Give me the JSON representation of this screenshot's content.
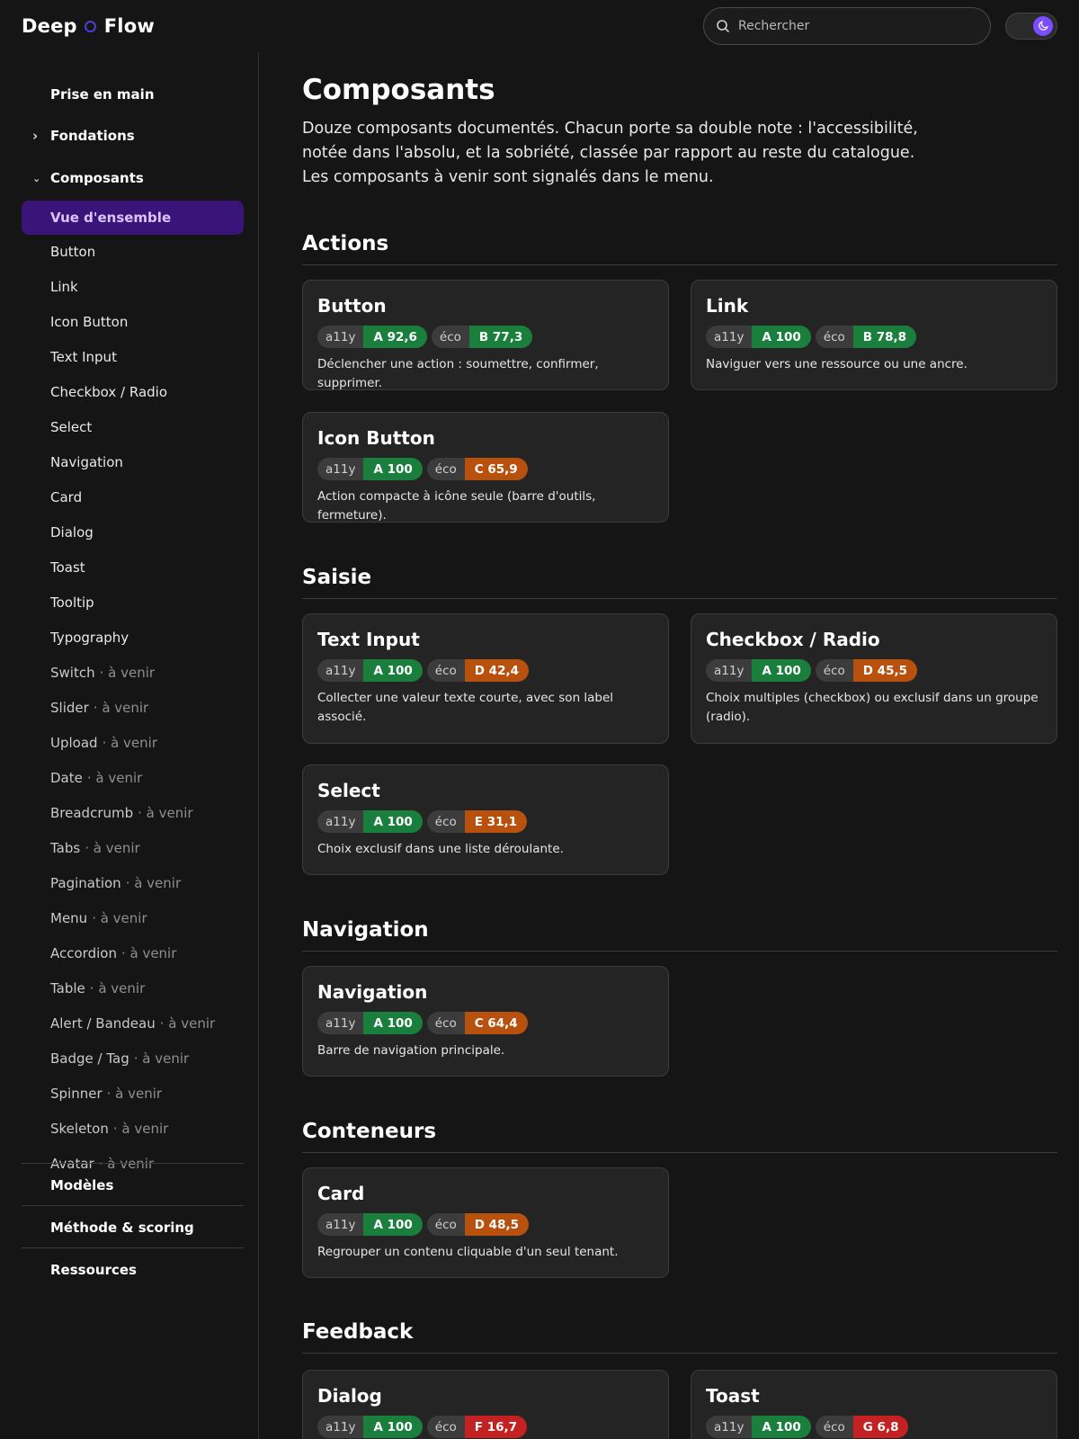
{
  "header": {
    "logo_left": "Deep",
    "logo_right": "Flow",
    "search_placeholder": "Rechercher",
    "theme_toggle": "moon-icon"
  },
  "sidebar": {
    "top_sections": [
      "Prise en main",
      "Fondations",
      "Composants"
    ],
    "active_item": "Vue d'ensemble",
    "items": [
      "Button",
      "Link",
      "Icon Button",
      "Text Input",
      "Checkbox / Radio",
      "Select",
      "Navigation",
      "Card",
      "Dialog",
      "Toast",
      "Tooltip",
      "Typography"
    ],
    "upcoming_suffix": "· à venir",
    "upcoming": [
      "Switch",
      "Slider",
      "Upload",
      "Date",
      "Breadcrumb",
      "Tabs",
      "Pagination",
      "Menu",
      "Accordion",
      "Table",
      "Alert / Bandeau",
      "Badge / Tag",
      "Spinner",
      "Skeleton",
      "Avatar"
    ],
    "bottom_sections": [
      "Modèles",
      "Méthode & scoring",
      "Ressources"
    ]
  },
  "main": {
    "title": "Composants",
    "intro": "Douze composants documentés. Chacun porte sa double note : l'accessibilité, notée dans l'absolu, et la sobriété, classée par rapport au reste du catalogue. Les composants à venir sont signalés dans le menu.",
    "a11y_label": "a11y",
    "eco_label": "éco",
    "grade_colors": {
      "A": "#1a7f3c",
      "B": "#1a7f3c",
      "C": "#b8510d",
      "D": "#b8510d",
      "E": "#b8510d",
      "F": "#c42222",
      "G": "#c42222"
    },
    "sections": [
      {
        "title": "Actions",
        "cards": [
          {
            "name": "Button",
            "a11y": "A 92,6",
            "eco": "B 77,3",
            "desc": "Déclencher une action : soumettre, confirmer, supprimer."
          },
          {
            "name": "Link",
            "a11y": "A 100",
            "eco": "B 78,8",
            "desc": "Naviguer vers une ressource ou une ancre."
          },
          {
            "name": "Icon Button",
            "a11y": "A 100",
            "eco": "C 65,9",
            "desc": "Action compacte à icône seule (barre d'outils, fermeture)."
          }
        ]
      },
      {
        "title": "Saisie",
        "cards": [
          {
            "name": "Text Input",
            "a11y": "A 100",
            "eco": "D 42,4",
            "desc": "Collecter une valeur texte courte, avec son label associé."
          },
          {
            "name": "Checkbox / Radio",
            "a11y": "A 100",
            "eco": "D 45,5",
            "desc": "Choix multiples (checkbox) ou exclusif dans un groupe (radio)."
          },
          {
            "name": "Select",
            "a11y": "A 100",
            "eco": "E 31,1",
            "desc": "Choix exclusif dans une liste déroulante."
          }
        ]
      },
      {
        "title": "Navigation",
        "cards": [
          {
            "name": "Navigation",
            "a11y": "A 100",
            "eco": "C 64,4",
            "desc": "Barre de navigation principale."
          }
        ]
      },
      {
        "title": "Conteneurs",
        "cards": [
          {
            "name": "Card",
            "a11y": "A 100",
            "eco": "D 48,5",
            "desc": "Regrouper un contenu cliquable d'un seul tenant."
          }
        ]
      },
      {
        "title": "Feedback",
        "cards": [
          {
            "name": "Dialog",
            "a11y": "A 100",
            "eco": "F 16,7",
            "desc": ""
          },
          {
            "name": "Toast",
            "a11y": "A 100",
            "eco": "G 6,8",
            "desc": ""
          }
        ]
      }
    ]
  }
}
